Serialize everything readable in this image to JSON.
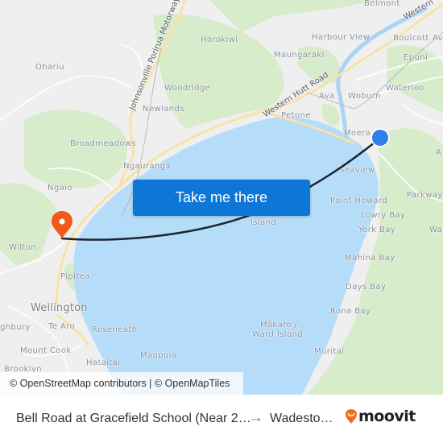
{
  "map": {
    "places": [
      {
        "id": "belmont",
        "label": "Belmont"
      },
      {
        "id": "harbour-view",
        "label": "Harbour View"
      },
      {
        "id": "boulcott",
        "label": "Boulcott"
      },
      {
        "id": "epuni",
        "label": "Epuni"
      },
      {
        "id": "horokiwi",
        "label": "Horokiwi"
      },
      {
        "id": "maungaraki",
        "label": "Maungaraki"
      },
      {
        "id": "ohariu",
        "label": "Ohariu"
      },
      {
        "id": "woodridge",
        "label": "Woodridge"
      },
      {
        "id": "newlands",
        "label": "Newlands"
      },
      {
        "id": "ava",
        "label": "Ava"
      },
      {
        "id": "woburn",
        "label": "Woburn"
      },
      {
        "id": "waterloo",
        "label": "Waterloo"
      },
      {
        "id": "petone",
        "label": "Petone"
      },
      {
        "id": "moera",
        "label": "Moera"
      },
      {
        "id": "broadmeadows",
        "label": "Broadmeadows"
      },
      {
        "id": "ngauranga",
        "label": "Ngauranga"
      },
      {
        "id": "seaview",
        "label": "Seaview"
      },
      {
        "id": "ngaio",
        "label": "Ngaio"
      },
      {
        "id": "point-howard",
        "label": "Point Howard"
      },
      {
        "id": "parkway",
        "label": "Parkway"
      },
      {
        "id": "lowry-bay",
        "label": "Lowry Bay"
      },
      {
        "id": "island",
        "label": "Island"
      },
      {
        "id": "york-bay",
        "label": "York Bay"
      },
      {
        "id": "wilton",
        "label": "Wilton"
      },
      {
        "id": "pipitea",
        "label": "Pipitea"
      },
      {
        "id": "mahina-bay",
        "label": "Mahina Bay"
      },
      {
        "id": "wellington",
        "label": "Wellington"
      },
      {
        "id": "days-bay",
        "label": "Days Bay"
      },
      {
        "id": "rona-bay",
        "label": "Rona Bay"
      },
      {
        "id": "highbury",
        "label": "ghbury"
      },
      {
        "id": "te-aro",
        "label": "Te Aro"
      },
      {
        "id": "roseneath",
        "label": "Roseneath"
      },
      {
        "id": "makaro",
        "label": "Mākaro /"
      },
      {
        "id": "ward-island",
        "label": "Ward Island"
      },
      {
        "id": "mount-cook",
        "label": "Mount Cook"
      },
      {
        "id": "hataitai",
        "label": "Hataitai"
      },
      {
        "id": "muritai",
        "label": "Muritai"
      },
      {
        "id": "maupuia",
        "label": "Maupuia"
      },
      {
        "id": "brooklyn",
        "label": "Brooklyn"
      },
      {
        "id": "miramar",
        "label": "Miramar"
      },
      {
        "id": "a-edge",
        "label": "A"
      },
      {
        "id": "av-edge",
        "label": "Av"
      },
      {
        "id": "wa-edge",
        "label": "Wa"
      }
    ],
    "roads": {
      "motorway": "Johnsonville Porirua Motorway",
      "western_hutt": "Western Hutt Road",
      "western_top": "Western"
    },
    "origin_marker": {
      "name": "Bell Road at Gracefield School",
      "color": "#2f80ed"
    },
    "destination_marker": {
      "name": "Wadestown",
      "color": "#f25a1c"
    },
    "route_color": "#1d2433",
    "water_color": "#b5dcf9",
    "land_color": "#efefef",
    "park_color": "#d6ebc8"
  },
  "cta": {
    "label": "Take me there",
    "color": "#0d77d8"
  },
  "attribution": "© OpenStreetMap contributors | © OpenMapTiles",
  "footer": {
    "from": "Bell Road at Gracefield School (Near 2…",
    "arrow": "→",
    "to": "Wadesto…",
    "brand": "moovit",
    "brand_color": "#f56a1e"
  }
}
